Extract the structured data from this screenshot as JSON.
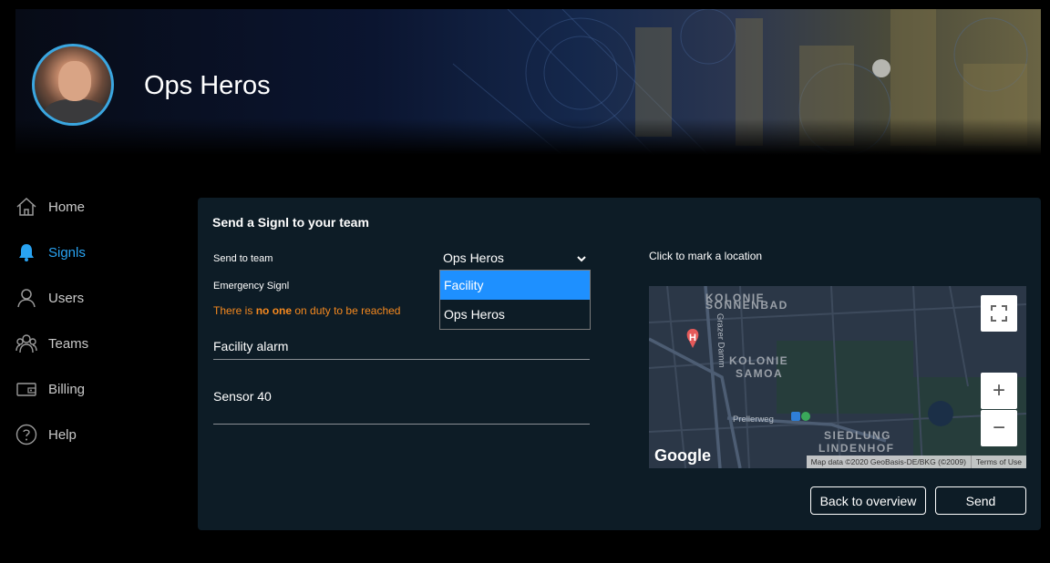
{
  "header": {
    "title": "Ops Heros"
  },
  "sidebar": {
    "items": [
      {
        "label": "Home",
        "icon": "home-icon",
        "active": false
      },
      {
        "label": "Signls",
        "icon": "bell-icon",
        "active": true
      },
      {
        "label": "Users",
        "icon": "user-icon",
        "active": false
      },
      {
        "label": "Teams",
        "icon": "team-icon",
        "active": false
      },
      {
        "label": "Billing",
        "icon": "wallet-icon",
        "active": false
      },
      {
        "label": "Help",
        "icon": "help-icon",
        "active": false
      }
    ]
  },
  "form": {
    "title": "Send a Signl to your team",
    "send_to_team_label": "Send to team",
    "emergency_label": "Emergency Signl",
    "warning": {
      "before": "There is",
      "strong": "no one",
      "after": "on duty to be reached"
    },
    "team_select_value": "Ops Heros",
    "team_options": [
      "Facility",
      "Ops Heros"
    ],
    "subject_value": "Facility alarm",
    "message_value": "Sensor 40"
  },
  "map": {
    "label": "Click to mark a location",
    "place_labels": [
      "KOLONIE",
      "SONNENBAD",
      "KOLONIE",
      "SAMOA",
      "SIEDLUNG",
      "LINDENHOF"
    ],
    "street_labels": [
      "Grazer Damm",
      "Prellerweg"
    ],
    "logo": "Google",
    "attribution": "Map data ©2020 GeoBasis-DE/BKG (©2009)",
    "terms": "Terms of Use",
    "zoom_in": "+",
    "zoom_out": "−"
  },
  "actions": {
    "back_label": "Back to overview",
    "send_label": "Send"
  },
  "colors": {
    "accent": "#29a3f2",
    "warning": "#f5891f",
    "panel": "#0d1c26",
    "selected_option": "#1e90ff"
  }
}
